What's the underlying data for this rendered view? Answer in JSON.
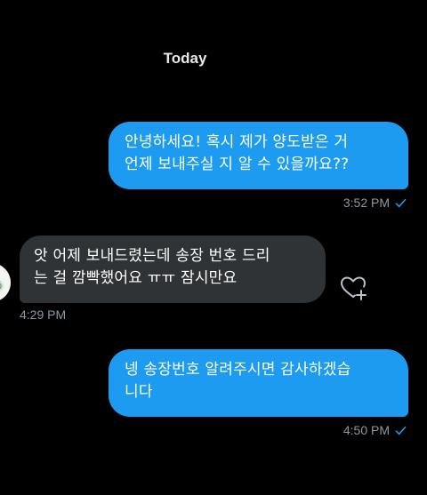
{
  "date_separator": "Today",
  "messages": [
    {
      "direction": "sent",
      "text": "안녕하세요! 혹시 제가 양도받은 거\n언제 보내주실 지 알 수 있을까요??",
      "time": "3:52 PM",
      "status_icon": "checkmark-icon"
    },
    {
      "direction": "received",
      "text": "앗 어제 보내드렸는데 송장 번호 드리\n는 걸 깜빡했어요 ㅠㅠ 잠시만요",
      "time": "4:29 PM",
      "reaction_icon": "heart-plus-icon"
    },
    {
      "direction": "sent",
      "text": "넹 송장번호 알려주시면 감사하겠습\n니다",
      "time": "4:50 PM",
      "status_icon": "checkmark-icon"
    }
  ],
  "colors": {
    "background": "#000000",
    "sent_bubble": "#1d9bf0",
    "received_bubble": "#2f3336",
    "meta_text": "#8b98a5",
    "check": "#1d9bf0"
  }
}
